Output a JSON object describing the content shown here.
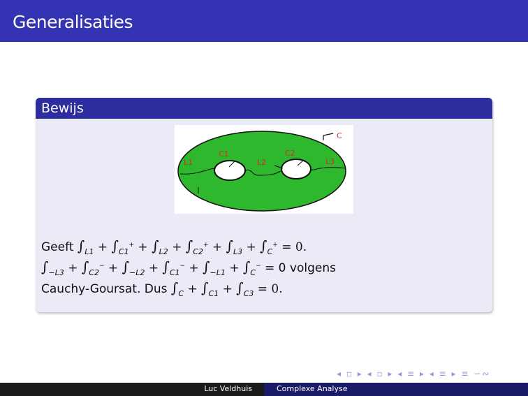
{
  "header": {
    "title": "Generalisaties"
  },
  "block": {
    "title": "Bewijs",
    "figure_labels": {
      "c": "C",
      "c1": "C1",
      "c2": "C2",
      "l1": "L1",
      "l2": "L2",
      "l3": "L3"
    },
    "line1": {
      "prefix": "Geeft",
      "t1": "L",
      "t1s": "1",
      "t2": "C",
      "t2s": "1",
      "t2p": "+",
      "t3": "L",
      "t3s": "2",
      "t4": "C",
      "t4s": "2",
      "t4p": "+",
      "t5": "L",
      "t5s": "3",
      "t6": "C",
      "t6p": "+",
      "end": "= 0."
    },
    "line2": {
      "t1": "−L",
      "t1s": "3",
      "t2": "C",
      "t2s": "2",
      "t2p": "−",
      "t3": "−L",
      "t3s": "2",
      "t4": "C",
      "t4s": "1",
      "t4p": "−",
      "t5": "−L",
      "t5s": "1",
      "t6": "C",
      "t6p": "−",
      "end": "= 0 volgens"
    },
    "line3": {
      "prefix": "Cauchy-Goursat. Dus",
      "t1": "C",
      "t2": "C",
      "t2s": "1",
      "t3": "C",
      "t3s": "3",
      "end": "= 0."
    },
    "symbols": {
      "integral": "∫",
      "plus": "+"
    }
  },
  "nav": {
    "symbols": "◂ ▫ ▸ ◂ ▫ ▸ ◂ ≡ ▸ ◂ ≡ ▸ ≡ ∽∾"
  },
  "footer": {
    "author": "Luc Veldhuis",
    "title": "Complexe Analyse"
  },
  "colors": {
    "header": "#3333b3",
    "block_title": "#2d2d9f",
    "block_body": "#ebebf7",
    "figure_green": "#2eb82e",
    "footer_dark": "#1a1a1a",
    "footer_blue": "#1a1a66"
  }
}
